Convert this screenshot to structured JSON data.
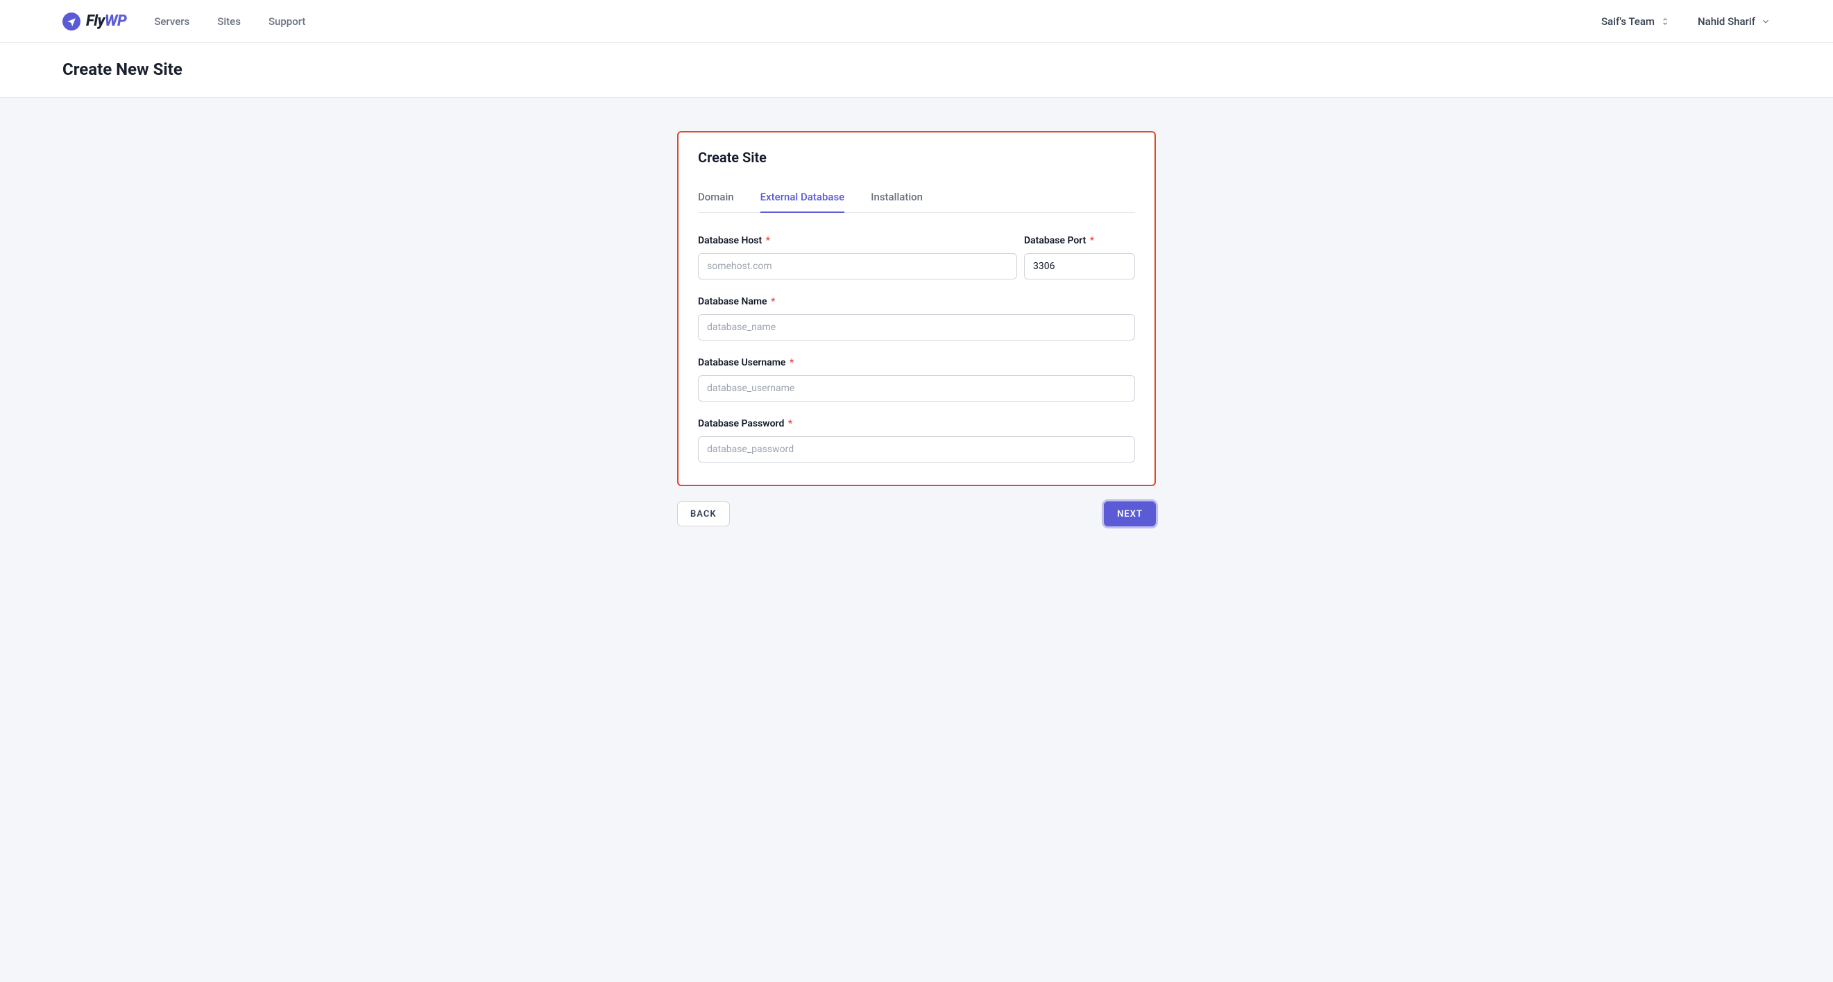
{
  "brand": {
    "name_prefix": "Fly",
    "name_suffix": "WP"
  },
  "nav": {
    "servers": "Servers",
    "sites": "Sites",
    "support": "Support"
  },
  "header": {
    "team_name": "Saif's Team",
    "user_name": "Nahid Sharif"
  },
  "page": {
    "title": "Create New Site"
  },
  "card": {
    "title": "Create Site",
    "tabs": {
      "domain": "Domain",
      "external_db": "External Database",
      "installation": "Installation"
    },
    "fields": {
      "db_host": {
        "label": "Database Host",
        "placeholder": "somehost.com",
        "value": ""
      },
      "db_port": {
        "label": "Database Port",
        "value": "3306"
      },
      "db_name": {
        "label": "Database Name",
        "placeholder": "database_name",
        "value": ""
      },
      "db_user": {
        "label": "Database Username",
        "placeholder": "database_username",
        "value": ""
      },
      "db_pass": {
        "label": "Database Password",
        "placeholder": "database_password",
        "value": ""
      }
    },
    "buttons": {
      "back": "BACK",
      "next": "NEXT"
    },
    "required_marker": "*"
  }
}
